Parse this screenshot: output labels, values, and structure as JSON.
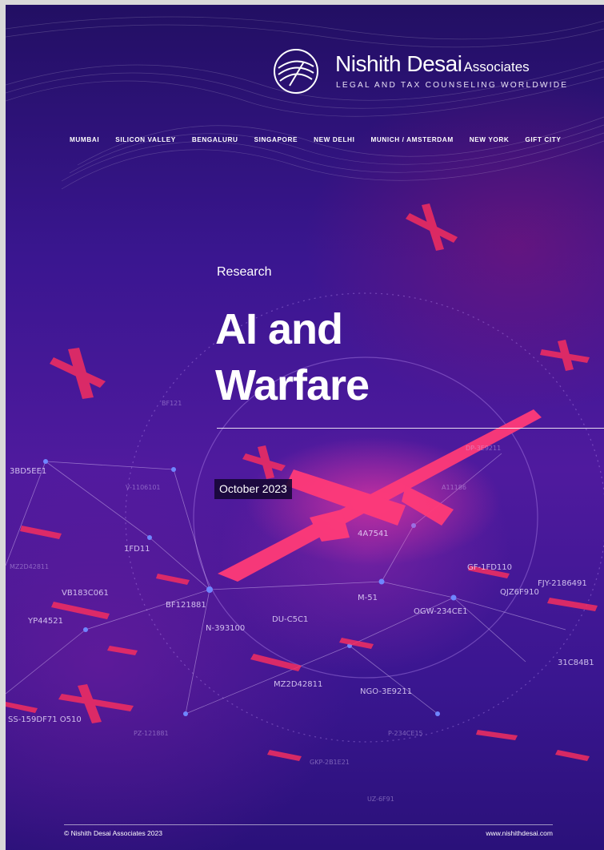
{
  "brand": {
    "name": "Nishith Desai",
    "associates": "Associates",
    "tagline": "LEGAL AND TAX COUNSELING WORLDWIDE"
  },
  "cities": [
    "MUMBAI",
    "SILICON VALLEY",
    "BENGALURU",
    "SINGAPORE",
    "NEW DELHI",
    "MUNICH / AMSTERDAM",
    "NEW YORK",
    "GIFT CITY"
  ],
  "cover": {
    "category": "Research",
    "title_line1": "AI and",
    "title_line2": "Warfare",
    "date": "October 2023"
  },
  "map_labels": [
    "3BD5EE1",
    "V-1106101",
    "1FD11",
    "MZ2D42811",
    "VB183C061",
    "YP44521",
    "BF121881",
    "N-393100",
    "DU-C5C1",
    "M-51",
    "4A7541",
    "GF-1FD110",
    "FJY-2186491",
    "QJZ6F910",
    "OGW-234CE1",
    "31C84B1",
    "MZ2D42811",
    "NGO-3E9211",
    "SS-159DF71 O510",
    "PZ-121881",
    "P-234CE15",
    "GKP-2B1E21",
    "UZ-6F91",
    "BF121",
    "A11186",
    "DP-3E9211"
  ],
  "colors": {
    "background": "#3a1690",
    "drone_red": "#e8294a",
    "node_blue": "#4a6cff",
    "date_badge_bg": "#14063280"
  },
  "footer": {
    "copyright": "© Nishith Desai Associates 2023",
    "website": "www.nishithdesai.com"
  }
}
